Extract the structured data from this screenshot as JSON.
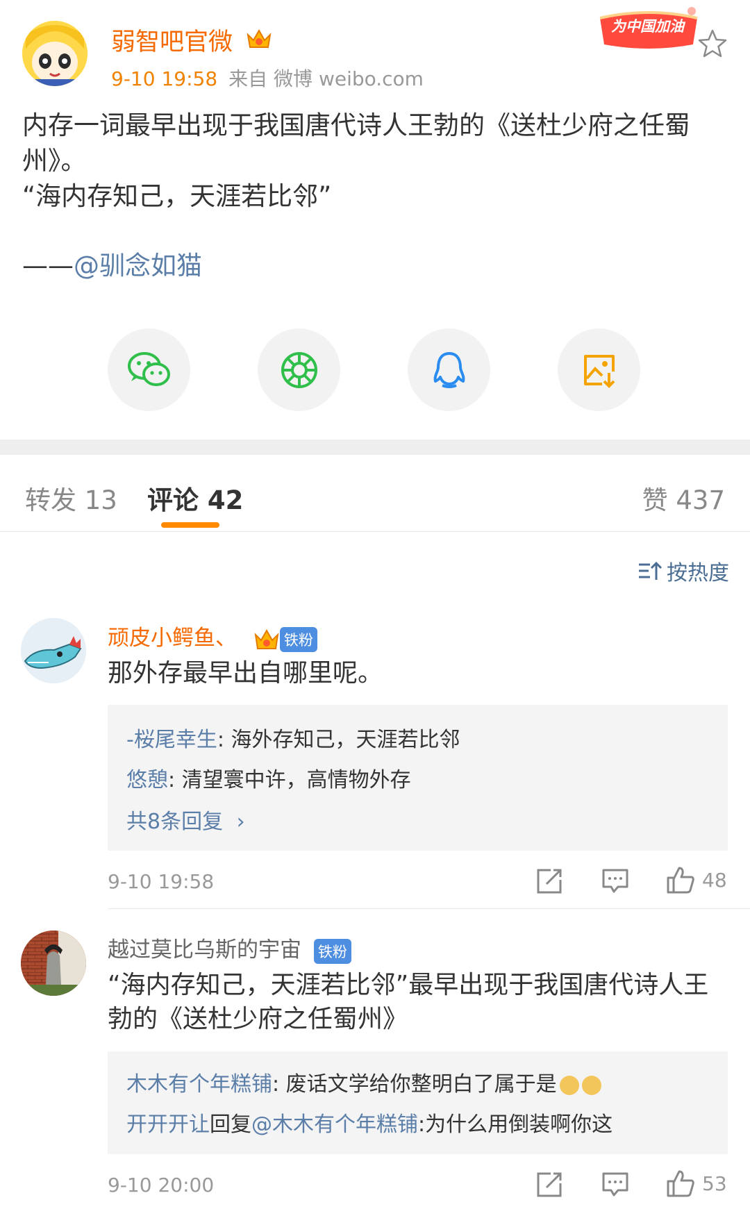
{
  "post": {
    "author": "弱智吧官微",
    "time": "9-10 19:58",
    "source": "来自 微博 weibo.com",
    "promo_badge_text": "为中国加油",
    "body_line1": "内存一词最早出现于我国唐代诗人王勃的《送杜少府之任蜀州》。",
    "body_line2": "“海内存知己，天涯若比邻”",
    "body_prefix": "——",
    "body_mention": "@驯念如猫"
  },
  "share": {
    "items": [
      "wechat-icon",
      "moments-icon",
      "qq-icon",
      "save-image-icon"
    ]
  },
  "tabs": {
    "repost": "转发 13",
    "comments": "评论 42",
    "likes": "赞 437"
  },
  "sort": {
    "label": "按热度"
  },
  "comments": [
    {
      "user": "顽皮小鳄鱼、",
      "badge": "铁粉",
      "text": "那外存最早出自哪里呢。",
      "replies": [
        {
          "user": "-桜尾幸生",
          "text": ": 海外存知己，天涯若比邻"
        },
        {
          "user": "悠憩",
          "text": ": 清望寰中许，高情物外存"
        }
      ],
      "more_replies": "共8条回复",
      "time": "9-10 19:58",
      "likes": "48"
    },
    {
      "user": "越过莫比乌斯的宇宙",
      "badge": "铁粉",
      "text": "“海内存知己，天涯若比邻”最早出现于我国唐代诗人王勃的《送杜少府之任蜀州》",
      "replies": [
        {
          "user": "木木有个年糕铺",
          "text": ": 废话文学给你整明白了属于是"
        },
        {
          "user": "开开开让",
          "mid": "回复",
          "user2": "@木木有个年糕铺",
          "text": ":为什么用倒装啊你这"
        }
      ],
      "time": "9-10 20:00",
      "likes": "53"
    }
  ],
  "colors": {
    "accent_orange": "#f56a00",
    "link_blue": "#5b7ea8",
    "tab_underline": "#ff8a00",
    "fan_badge": "#4e8ee0"
  }
}
